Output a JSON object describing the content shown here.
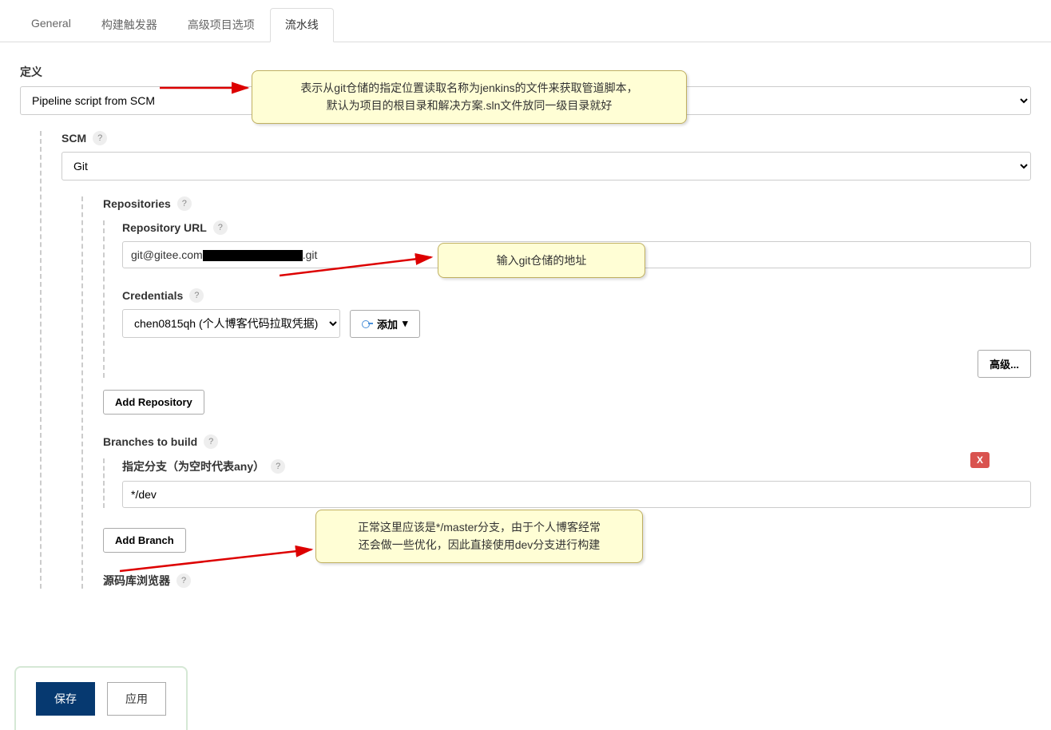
{
  "tabs": {
    "general": "General",
    "trigger": "构建触发器",
    "advanced": "高级项目选项",
    "pipeline": "流水线"
  },
  "definition": {
    "label": "定义",
    "value": "Pipeline script from SCM"
  },
  "scm": {
    "label": "SCM",
    "value": "Git"
  },
  "repositories": {
    "label": "Repositories",
    "urlLabel": "Repository URL",
    "urlPrefix": "git@gitee.com",
    "urlSuffix": ".git",
    "credsLabel": "Credentials",
    "credsValue": "chen0815qh (个人博客代码拉取凭据)",
    "addCredBtn": "添加",
    "advancedBtn": "高级...",
    "addRepoBtn": "Add Repository"
  },
  "branches": {
    "label": "Branches to build",
    "specLabel": "指定分支（为空时代表any）",
    "value": "*/dev",
    "addBranchBtn": "Add Branch",
    "deleteBtn": "X"
  },
  "sourceBrowser": {
    "label": "源码库浏览器"
  },
  "footer": {
    "save": "保存",
    "apply": "应用"
  },
  "callouts": {
    "c1_l1": "表示从git仓储的指定位置读取名称为jenkins的文件来获取管道脚本，",
    "c1_l2": "默认为项目的根目录和解决方案.sln文件放同一级目录就好",
    "c2": "输入git仓储的地址",
    "c3_l1": "正常这里应该是*/master分支，由于个人博客经常",
    "c3_l2": "还会做一些优化，因此直接使用dev分支进行构建"
  }
}
